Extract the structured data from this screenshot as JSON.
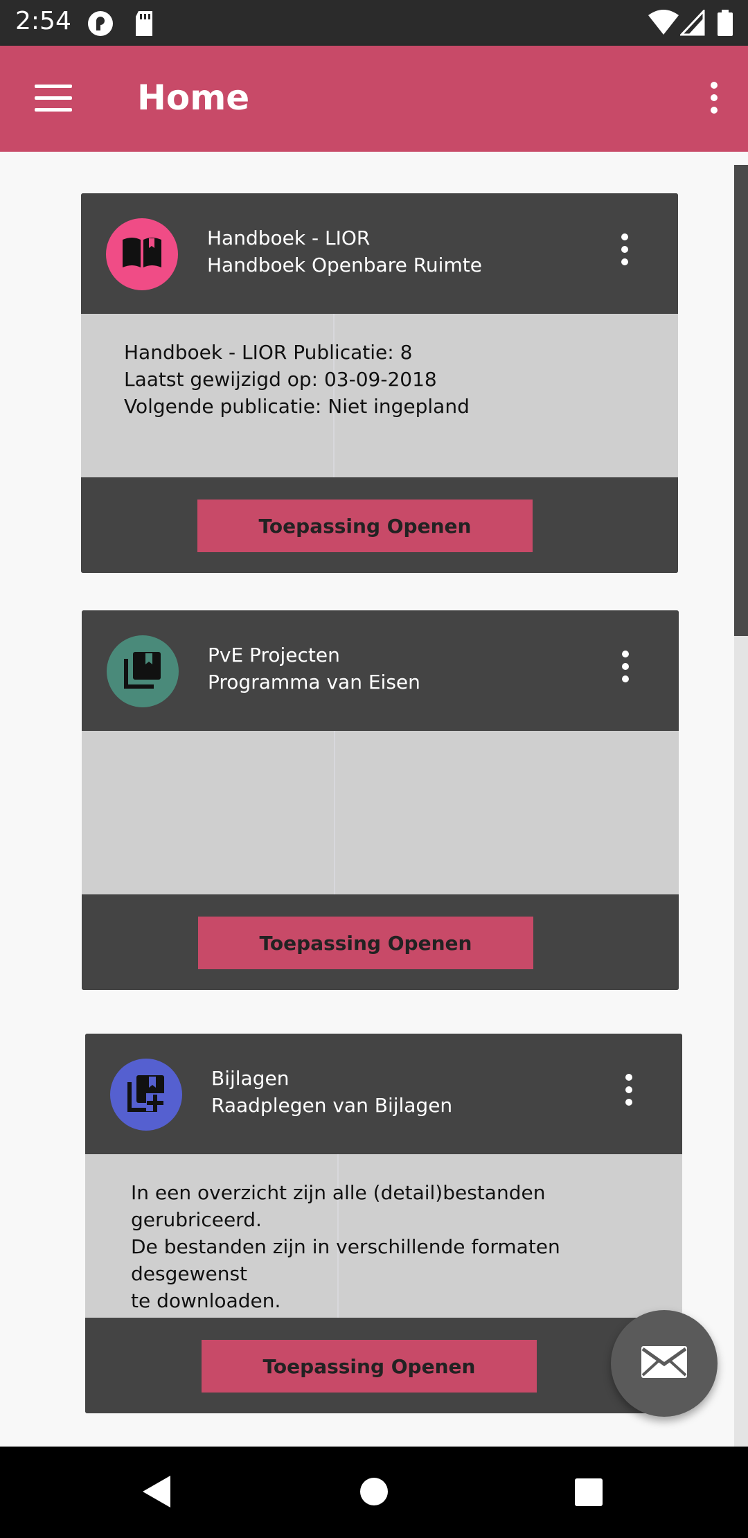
{
  "status_bar": {
    "time": "2:54"
  },
  "app_bar": {
    "title": "Home"
  },
  "cards": [
    {
      "icon": "book-open-icon",
      "avatar_color": "#f04c86",
      "title": "Handboek - LIOR",
      "subtitle": "Handboek Openbare Ruimte",
      "body_lines": [
        "Handboek - LIOR Publicatie: 8",
        "Laatst gewijzigd op: 03-09-2018",
        "Volgende publicatie: Niet ingepland"
      ],
      "button_label": "Toepassing Openen"
    },
    {
      "icon": "library-books-icon",
      "avatar_color": "#4a8a7a",
      "title": "PvE Projecten",
      "subtitle": "Programma van Eisen",
      "body_lines": [],
      "button_label": "Toepassing Openen"
    },
    {
      "icon": "library-add-icon",
      "avatar_color": "#5560d0",
      "title": "Bijlagen",
      "subtitle": "Raadplegen van Bijlagen",
      "body_lines": [
        "In een overzicht zijn alle (detail)bestanden gerubriceerd.",
        "De bestanden zijn in verschillende formaten desgewenst",
        "te downloaden."
      ],
      "button_label": "Toepassing Openen"
    }
  ],
  "fab": {
    "icon": "mail-icon"
  },
  "nav_bar": {
    "back": "back-icon",
    "home": "home-icon",
    "recents": "recents-icon"
  },
  "colors": {
    "brand": "#c84a68",
    "card_dark": "#444444",
    "card_body": "#cfcfcf"
  }
}
